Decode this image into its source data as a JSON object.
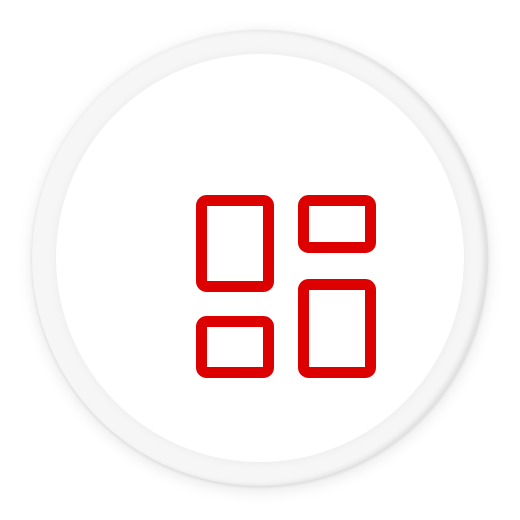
{
  "button": {
    "icon": "dashboard-grid-icon",
    "accent_color": "#dd0000",
    "ring_color": "#f6f6f6",
    "face_color": "#ffffff"
  }
}
